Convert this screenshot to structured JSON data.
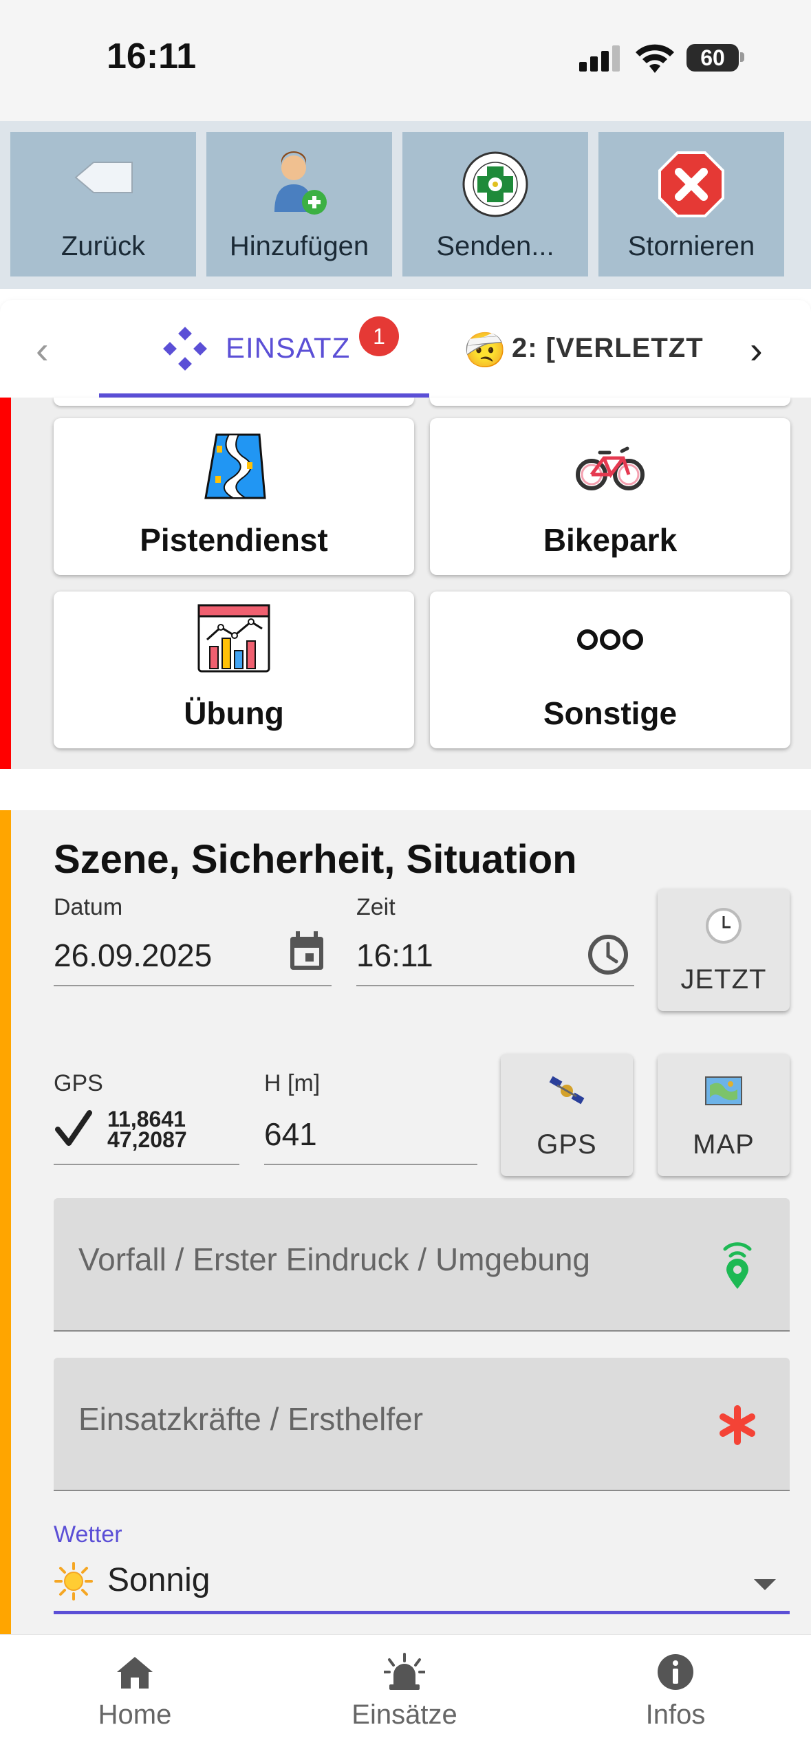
{
  "status": {
    "time": "16:11",
    "battery": "60"
  },
  "toolbar": {
    "back_label": "Zurück",
    "add_label": "Hinzufügen",
    "send_label": "Senden...",
    "cancel_label": "Stornieren"
  },
  "tabs": {
    "einsatz_label": "EINSATZ",
    "einsatz_badge": "1",
    "patient_emoji": "🤕",
    "patient_label": "2: [VERLETZT"
  },
  "categories": [
    {
      "label": "Pistendienst",
      "icon": "ski-slope-icon"
    },
    {
      "label": "Bikepark",
      "icon": "bicycle-icon"
    },
    {
      "label": "Übung",
      "icon": "chart-dashboard-icon"
    },
    {
      "label": "Sonstige",
      "icon": "more-icon"
    }
  ],
  "scene": {
    "title": "Szene, Sicherheit, Situation",
    "date_label": "Datum",
    "date_value": "26.09.2025",
    "time_label": "Zeit",
    "time_value": "16:11",
    "now_button": "JETZT",
    "gps_label": "GPS",
    "gps_lon": "11,8641",
    "gps_lat": "47,2087",
    "height_label": "H [m]",
    "height_value": "641",
    "gps_button": "GPS",
    "map_button": "MAP",
    "incident_placeholder": "Vorfall / Erster Eindruck / Umgebung",
    "forces_placeholder": "Einsatzkräfte / Ersthelfer",
    "weather_label": "Wetter",
    "weather_value": "Sonnig"
  },
  "nav": {
    "home": "Home",
    "einsaetze": "Einsätze",
    "infos": "Infos"
  },
  "colors": {
    "accent": "#5b4fd6",
    "toolbar_button": "#a8bfcf",
    "bar_red": "#ff0000",
    "bar_orange": "#ffa500",
    "badge": "#e53935",
    "required": "#f44336",
    "location_green": "#1db954"
  }
}
